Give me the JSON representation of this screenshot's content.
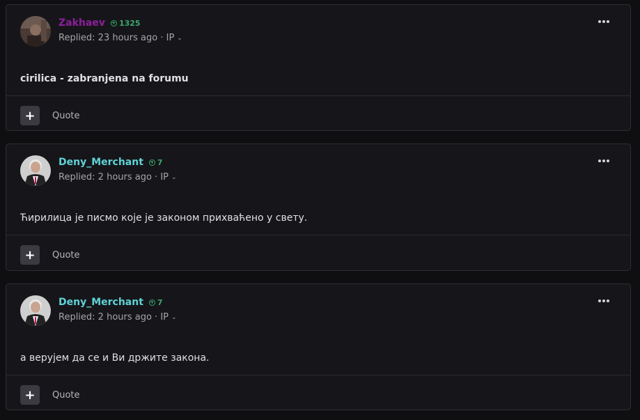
{
  "posts": [
    {
      "username": "Zakhaev",
      "username_color": "#8d1f9c",
      "reputation": "1325",
      "meta": "Replied: 23 hours ago · IP",
      "content": "cirilica - zabranjena na forumu",
      "content_bold": true,
      "quote_label": "Quote",
      "avatar": "user-photo-dark"
    },
    {
      "username": "Deny_Merchant",
      "username_color": "#5fd3d6",
      "reputation": "7",
      "meta": "Replied: 2 hours ago · IP",
      "content": "Ћирилица је писмо које је законом прихваћено у свету.",
      "content_bold": false,
      "quote_label": "Quote",
      "avatar": "user-photo-man-suit"
    },
    {
      "username": "Deny_Merchant",
      "username_color": "#5fd3d6",
      "reputation": "7",
      "meta": "Replied: 2 hours ago · IP",
      "content": "а верујем да се и Ви држите закона.",
      "content_bold": false,
      "quote_label": "Quote",
      "avatar": "user-photo-man-suit"
    }
  ],
  "icons": {
    "more": "ellipsis-icon",
    "add": "plus-icon",
    "reputation": "plus-circle-icon",
    "dropdown": "chevron-down-icon"
  }
}
